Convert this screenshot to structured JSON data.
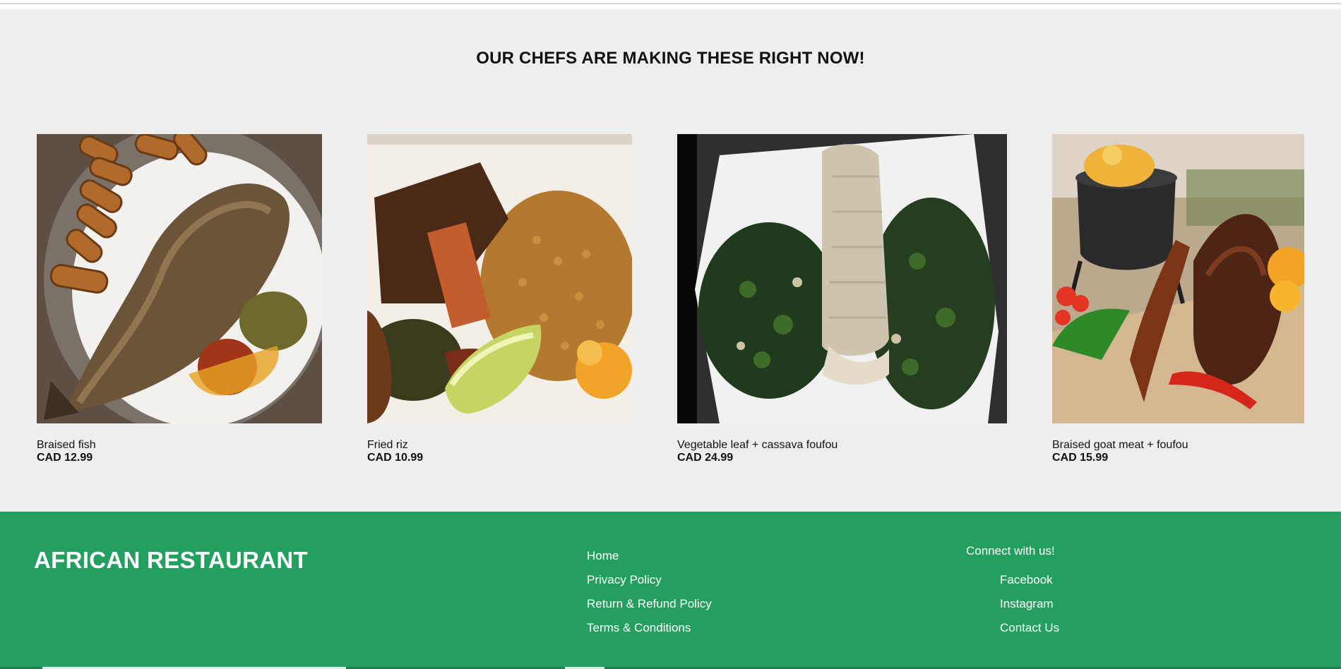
{
  "section": {
    "title": "OUR CHEFS ARE MAKING THESE RIGHT NOW!"
  },
  "dishes": [
    {
      "name": "Braised fish",
      "price": "CAD 12.99"
    },
    {
      "name": "Fried riz",
      "price": "CAD 10.99"
    },
    {
      "name": "Vegetable leaf + cassava foufou",
      "price": "CAD 24.99"
    },
    {
      "name": "Braised goat meat + foufou",
      "price": "CAD 15.99"
    }
  ],
  "footer": {
    "brand": "AFRICAN RESTAURANT",
    "links": [
      "Home",
      "Privacy Policy",
      "Return & Refund Policy",
      "Terms & Conditions"
    ],
    "connect_label": "Connect with us!",
    "social": [
      "Facebook",
      "Instagram",
      "Contact Us"
    ]
  },
  "colors": {
    "section_bg": "#eeeeee",
    "footer_bg": "#239f5f",
    "footer_text": "#ffffff"
  }
}
